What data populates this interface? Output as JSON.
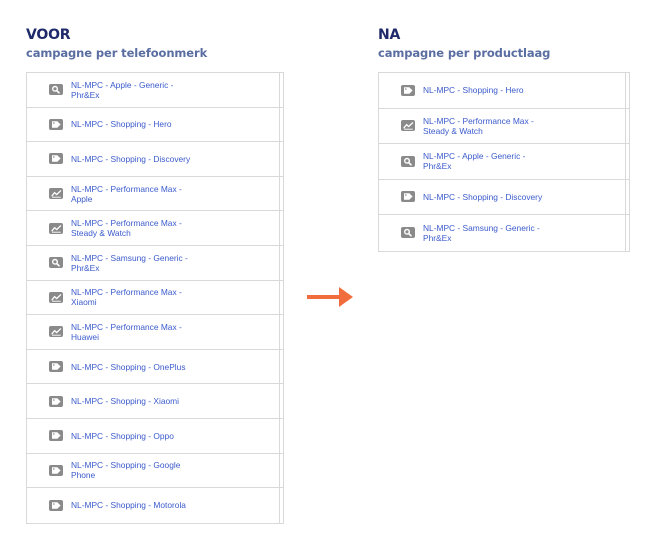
{
  "before": {
    "title": "VOOR",
    "subtitle": "campagne per telefoonmerk",
    "items": [
      {
        "icon": "search-icon",
        "label": "NL-MPC - Apple - Generic - Phr&Ex"
      },
      {
        "icon": "tag-icon",
        "label": "NL-MPC - Shopping - Hero"
      },
      {
        "icon": "tag-icon",
        "label": "NL-MPC - Shopping - Discovery"
      },
      {
        "icon": "performance-icon",
        "label": "NL-MPC - Performance Max - Apple"
      },
      {
        "icon": "performance-icon",
        "label": "NL-MPC - Performance Max - Steady & Watch"
      },
      {
        "icon": "search-icon",
        "label": "NL-MPC - Samsung - Generic - Phr&Ex"
      },
      {
        "icon": "performance-icon",
        "label": "NL-MPC - Performance Max - Xiaomi"
      },
      {
        "icon": "performance-icon",
        "label": "NL-MPC - Performance Max - Huawei"
      },
      {
        "icon": "tag-icon",
        "label": "NL-MPC - Shopping - OnePlus"
      },
      {
        "icon": "tag-icon",
        "label": "NL-MPC - Shopping - Xiaomi"
      },
      {
        "icon": "tag-icon",
        "label": "NL-MPC - Shopping - Oppo"
      },
      {
        "icon": "tag-icon",
        "label": "NL-MPC - Shopping - Google Phone"
      },
      {
        "icon": "tag-icon",
        "label": "NL-MPC - Shopping - Motorola"
      }
    ]
  },
  "after": {
    "title": "NA",
    "subtitle": "campagne per productlaag",
    "items": [
      {
        "icon": "tag-icon",
        "label": "NL-MPC - Shopping - Hero"
      },
      {
        "icon": "performance-icon",
        "label": "NL-MPC - Performance Max - Steady & Watch"
      },
      {
        "icon": "search-icon",
        "label": "NL-MPC - Apple - Generic - Phr&Ex"
      },
      {
        "icon": "tag-icon",
        "label": "NL-MPC - Shopping - Discovery"
      },
      {
        "icon": "search-icon",
        "label": "NL-MPC - Samsung - Generic - Phr&Ex"
      }
    ]
  },
  "arrow": {
    "icon": "arrow-right-icon",
    "color": "#f26d3d"
  },
  "colors": {
    "heading": "#1f2a6b",
    "subheading": "#5a6ea1",
    "link": "#3b5bcc",
    "icon_bg": "#8a8a8a",
    "border": "#d9d9d9"
  }
}
